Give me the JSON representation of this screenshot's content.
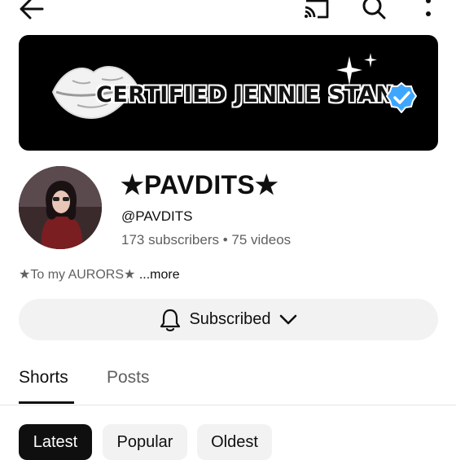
{
  "toolbar": {
    "back_icon": "arrow-left-icon",
    "cast_icon": "cast-icon",
    "search_icon": "search-icon",
    "more_icon": "more-vertical-icon"
  },
  "banner": {
    "text": "CERTIFIED JENNIE STAN",
    "icons": [
      "lips-icon",
      "sparkle-icon",
      "verified-check-icon"
    ]
  },
  "channel": {
    "name": "★PAVDITS★",
    "handle": "@PAVDITS",
    "stats": "173 subscribers • 75 videos",
    "description": "★To my AURORS★",
    "more_label": " ...more"
  },
  "subscribe": {
    "label": "Subscribed",
    "bell_icon": "bell-icon",
    "chevron_icon": "chevron-down-icon"
  },
  "tabs": [
    {
      "label": "Shorts",
      "active": true
    },
    {
      "label": "Posts",
      "active": false
    }
  ],
  "filters": [
    {
      "label": "Latest",
      "active": true
    },
    {
      "label": "Popular",
      "active": false
    },
    {
      "label": "Oldest",
      "active": false
    }
  ],
  "colors": {
    "accent": "#0f0f0f",
    "muted": "#606060",
    "chip_bg": "#f2f2f2",
    "verified": "#3ea6ff"
  }
}
